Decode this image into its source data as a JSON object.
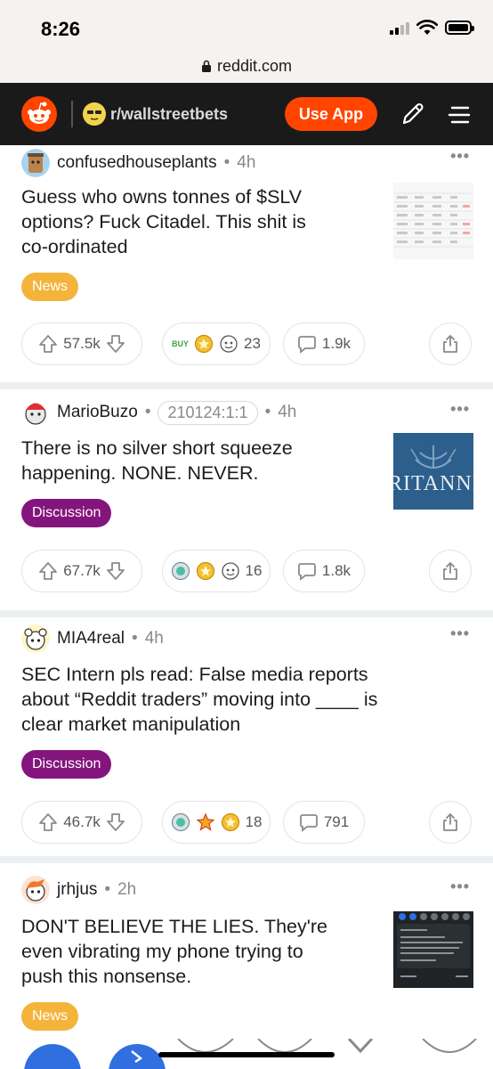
{
  "status": {
    "time": "8:26"
  },
  "browser": {
    "url": "reddit.com"
  },
  "header": {
    "subreddit": "r/wallstreetbets",
    "use_app_label": "Use App",
    "brand_color": "#ff4500"
  },
  "posts": [
    {
      "author": "confusedhouseplants",
      "age": "4h",
      "user_flair": "",
      "title_lines": [
        "Guess who owns tonnes of $SLV",
        "options? Fuck Citadel. This shit is",
        "co-ordinated"
      ],
      "tag": "News",
      "upvotes": "57.5k",
      "award_count": "23",
      "award_prefix": "BUY",
      "comments": "1.9k"
    },
    {
      "author": "MarioBuzo",
      "age": "4h",
      "user_flair": "210124:1:1",
      "title_lines": [
        "There is no silver short squeeze",
        "happening. NONE. NEVER."
      ],
      "tag": "Discussion",
      "thumb_text": "RITANNIC",
      "upvotes": "67.7k",
      "award_count": "16",
      "comments": "1.8k"
    },
    {
      "author": "MIA4real",
      "age": "4h",
      "user_flair": "",
      "title_lines": [
        "SEC Intern pls read: False media reports",
        "about “Reddit traders” moving into ____ is",
        "clear market manipulation"
      ],
      "tag": "Discussion",
      "upvotes": "46.7k",
      "award_count": "18",
      "comments": "791"
    },
    {
      "author": "jrhjus",
      "age": "2h",
      "user_flair": "",
      "title_lines": [
        "DON'T BELIEVE THE LIES. They're",
        "even vibrating my phone trying to",
        "push this nonsense."
      ],
      "tag": "News"
    }
  ]
}
